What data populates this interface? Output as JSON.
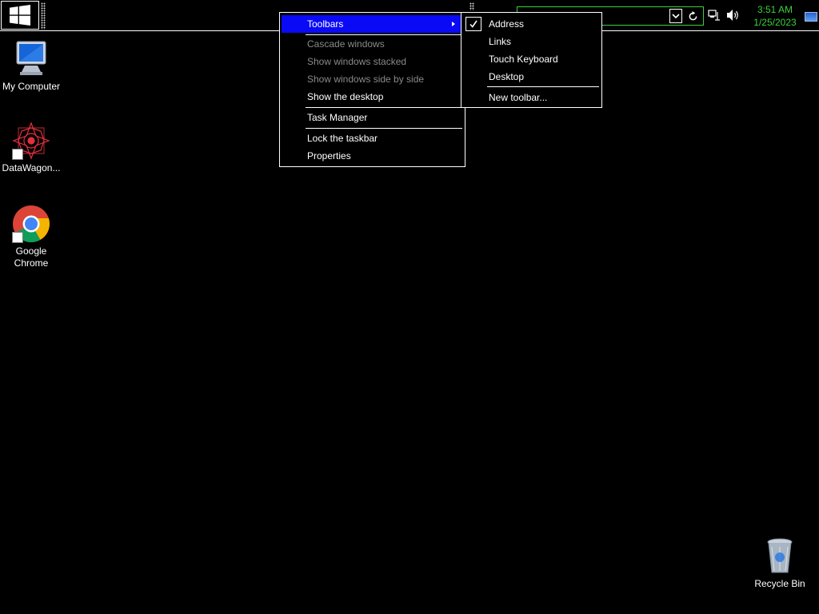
{
  "taskbar": {
    "clock": {
      "time": "3:51 AM",
      "date": "1/25/2023"
    },
    "icons": [
      "windows-logo-icon",
      "network-icon",
      "volume-icon",
      "refresh-icon",
      "chevron-down-icon",
      "show-desktop-icon"
    ]
  },
  "desktop": {
    "icons": [
      {
        "label": "My Computer",
        "icon": "computer-icon"
      },
      {
        "label": "DataWagon...",
        "icon": "datawagon-icon"
      },
      {
        "label": "Google Chrome",
        "icon": "chrome-icon"
      },
      {
        "label": "Recycle Bin",
        "icon": "recycle-bin-icon"
      }
    ]
  },
  "context_menu": {
    "toolbars": "Toolbars",
    "cascade": "Cascade windows",
    "stacked": "Show windows stacked",
    "side_by_side": "Show windows side by side",
    "show_desktop": "Show the desktop",
    "task_manager": "Task Manager",
    "lock_taskbar": "Lock the taskbar",
    "properties": "Properties"
  },
  "toolbars_submenu": {
    "address": "Address",
    "address_checked": true,
    "links": "Links",
    "touch_keyboard": "Touch Keyboard",
    "desktop": "Desktop",
    "new_toolbar": "New toolbar..."
  },
  "colors": {
    "highlight": "#0a0af6",
    "clock": "#3ad13a",
    "disabled": "#8a8a8a"
  }
}
